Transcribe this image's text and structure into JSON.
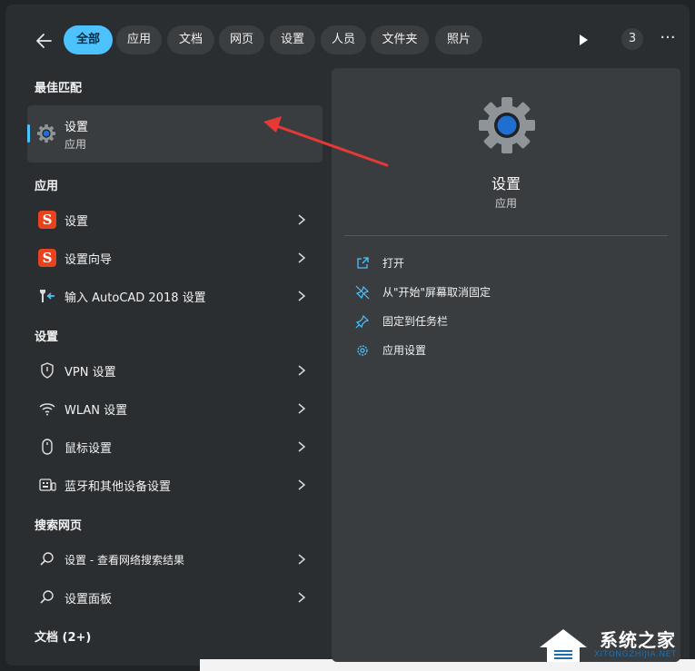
{
  "filters": {
    "tabs": [
      {
        "label": "全部",
        "active": true
      },
      {
        "label": "应用"
      },
      {
        "label": "文档"
      },
      {
        "label": "网页"
      },
      {
        "label": "设置"
      },
      {
        "label": "人员"
      },
      {
        "label": "文件夹"
      },
      {
        "label": "照片"
      }
    ],
    "count": "3",
    "more": "···"
  },
  "sections": {
    "best_match": "最佳匹配",
    "apps": "应用",
    "settings": "设置",
    "web": "搜索网页",
    "docs": "文档 (2+)"
  },
  "best_match": {
    "title": "设置",
    "subtitle": "应用",
    "icon": "gear-icon"
  },
  "apps": [
    {
      "label": "设置",
      "icon": "sogou-icon",
      "glyph": "S"
    },
    {
      "label": "设置向导",
      "icon": "sogou-icon",
      "glyph": "S"
    },
    {
      "label": "输入 AutoCAD 2018 设置",
      "icon": "autocad-tool-icon"
    }
  ],
  "settings": [
    {
      "label": "VPN 设置",
      "icon": "shield-icon"
    },
    {
      "label": "WLAN 设置",
      "icon": "wifi-icon"
    },
    {
      "label": "鼠标设置",
      "icon": "mouse-icon"
    },
    {
      "label": "蓝牙和其他设备设置",
      "icon": "keyboard-device-icon"
    }
  ],
  "web": [
    {
      "label": "设置 - 查看网络搜索结果",
      "icon": "search-icon"
    },
    {
      "label": "设置面板",
      "icon": "search-icon"
    }
  ],
  "detail": {
    "title": "设置",
    "subtitle": "应用",
    "actions": [
      {
        "label": "打开",
        "icon": "open-external-icon"
      },
      {
        "label": "从\"开始\"屏幕取消固定",
        "icon": "unpin-icon"
      },
      {
        "label": "固定到任务栏",
        "icon": "pin-icon"
      },
      {
        "label": "应用设置",
        "icon": "gear-small-icon"
      }
    ]
  },
  "watermark": {
    "text": "系统之家",
    "sub": "XITONGZHIJIA.NET"
  },
  "colors": {
    "accent": "#4cc2ff",
    "panel": "#2b2e31",
    "pane": "#3a3d40",
    "arrow": "#e53935",
    "sogou": "#e8431d"
  }
}
